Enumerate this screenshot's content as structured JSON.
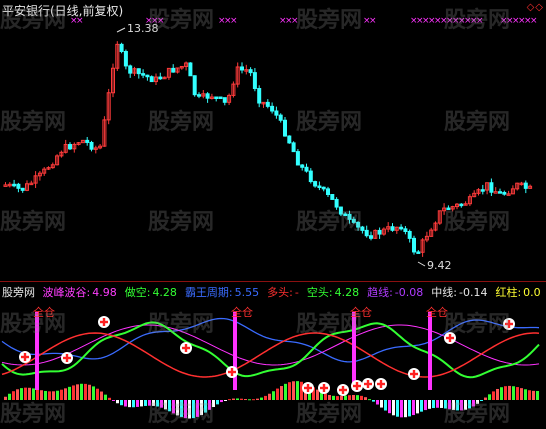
{
  "title": "平安银行(日线,前复权)",
  "price": {
    "high": "13.38",
    "low": "9.42"
  },
  "indicator": {
    "name": "股旁网",
    "items": [
      {
        "label": "波峰波谷:",
        "value": "4.98",
        "color": "#ff3dff"
      },
      {
        "label": "做空:",
        "value": "4.28",
        "color": "#33ff33"
      },
      {
        "label": "霸王周期:",
        "value": "5.55",
        "color": "#3a6bff"
      },
      {
        "label": "多头:",
        "value": "-",
        "color": "#ff3030"
      },
      {
        "label": "空头:",
        "value": "4.28",
        "color": "#33ff33"
      },
      {
        "label": "趋线:",
        "value": "-0.08",
        "color": "#b03cff"
      },
      {
        "label": "中线:",
        "value": "-0.14",
        "color": "#e8e8e8"
      },
      {
        "label": "红柱:",
        "value": "0.0",
        "color": "#ffff33"
      }
    ]
  },
  "signal_label": "全仓",
  "watermark": "股旁网",
  "colors": {
    "up": "#ff3b3b",
    "down": "#33ffff",
    "bg": "#000000",
    "marker": "#ff33ff"
  }
}
